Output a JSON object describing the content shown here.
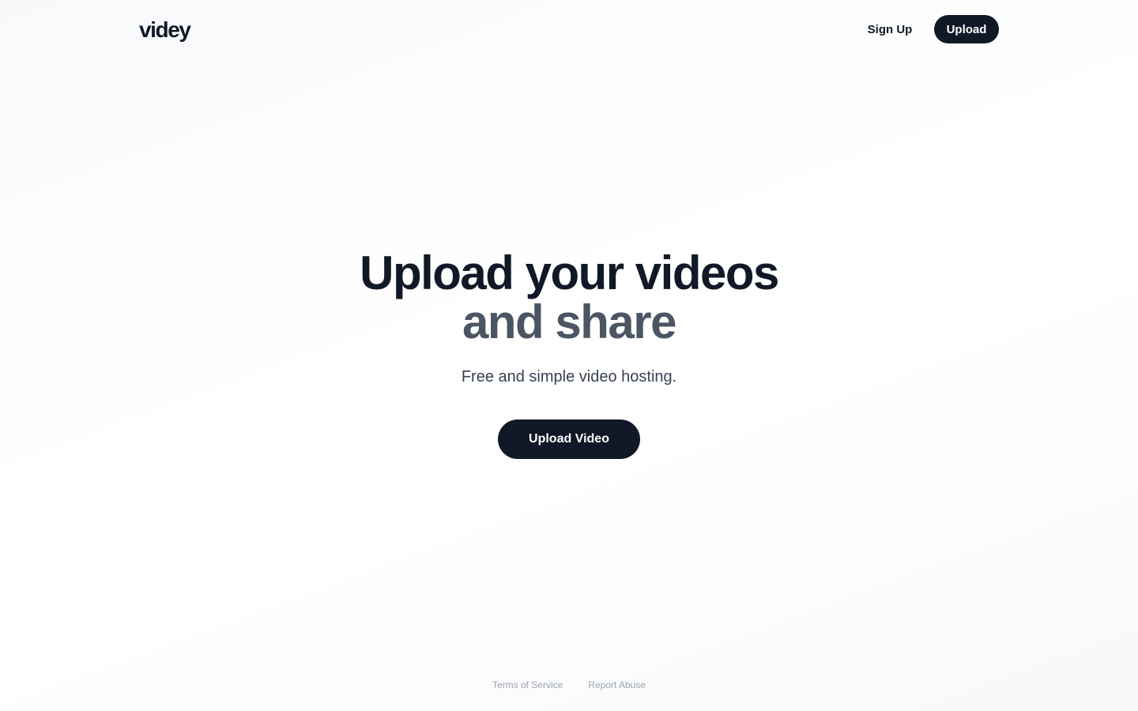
{
  "header": {
    "logo": "videy",
    "nav": {
      "signup_label": "Sign Up",
      "upload_label": "Upload"
    }
  },
  "hero": {
    "headline_line1": "Upload your videos",
    "headline_line2": "and share",
    "subtitle": "Free and simple video hosting.",
    "cta_label": "Upload Video"
  },
  "footer": {
    "links": [
      {
        "label": "Terms of Service"
      },
      {
        "label": "Report Abuse"
      }
    ]
  },
  "colors": {
    "primary": "#111827",
    "secondary_text": "#4b5563",
    "muted": "#9ca3af"
  }
}
